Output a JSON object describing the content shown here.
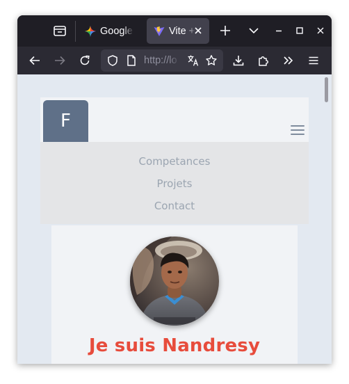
{
  "browser": {
    "tabs": [
      {
        "title": "Google G",
        "favicon": "google-gemini-icon",
        "active": false
      },
      {
        "title": "Vite + R",
        "favicon": "vite-icon",
        "active": true
      }
    ],
    "url": "http://lo",
    "icons": [
      "tab-list-icon",
      "new-tab-icon",
      "list-all-tabs-icon",
      "minimize-icon",
      "maximize-icon",
      "close-window-icon",
      "back-icon",
      "forward-icon",
      "reload-icon",
      "shield-icon",
      "page-icon",
      "translate-icon",
      "bookmark-star-icon",
      "downloads-icon",
      "extensions-icon",
      "overflow-icon",
      "menu-icon"
    ]
  },
  "page": {
    "logo_letter": "F",
    "menu": [
      {
        "label": "Competances"
      },
      {
        "label": "Projets"
      },
      {
        "label": "Contact"
      }
    ],
    "hero_title": "Je suis Nandresy"
  },
  "colors": {
    "chrome_dark": "#1f1e25",
    "toolbar": "#2b2a33",
    "page_bg": "#e3e9f1",
    "logo_bg": "#5f7088",
    "menu_text": "#9ba5b1",
    "accent_red": "#e74c3c"
  }
}
